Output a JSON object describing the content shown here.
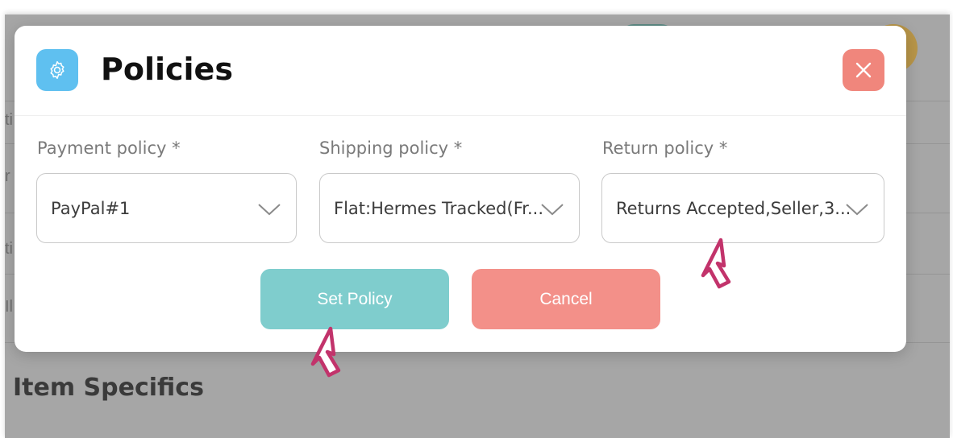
{
  "background": {
    "section_heading": "Item Specifics",
    "edge_fragments": [
      "ti",
      "r",
      "ti",
      "Il"
    ]
  },
  "modal": {
    "icon": "gear-icon",
    "title": "Policies",
    "close_icon": "close-icon",
    "fields": [
      {
        "label": "Payment policy *",
        "value": "PayPal#1"
      },
      {
        "label": "Shipping policy *",
        "value": "Flat:Hermes Tracked(Fr..."
      },
      {
        "label": "Return policy *",
        "value": "Returns Accepted,Seller,3..."
      }
    ],
    "buttons": {
      "set_policy": "Set Policy",
      "cancel": "Cancel"
    }
  },
  "colors": {
    "accent_blue": "#5fc0f0",
    "close_red": "#f0867c",
    "set_policy_teal": "#7fcdcd",
    "cancel_red": "#f39089",
    "pointer_outline": "#c2336b"
  }
}
